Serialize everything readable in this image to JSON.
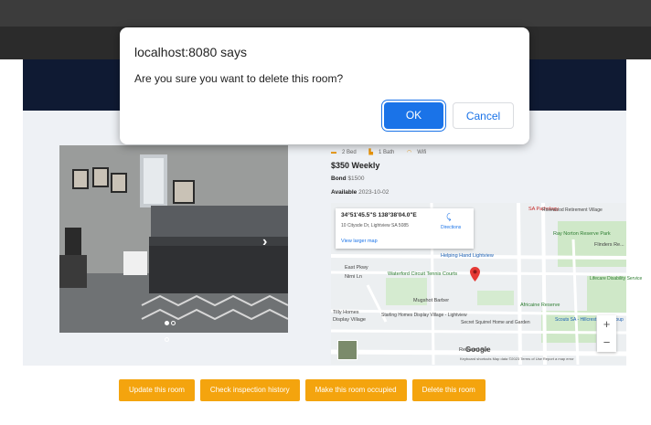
{
  "dialog": {
    "title": "localhost:8080 says",
    "message": "Are you sure you want to delete this room?",
    "ok_label": "OK",
    "cancel_label": "Cancel"
  },
  "room": {
    "features": {
      "beds": "2 Bed",
      "baths": "1 Bath",
      "wifi": "Wifi"
    },
    "price": "$350 Weekly",
    "bond_label": "Bond",
    "bond_value": "$1500",
    "available_label": "Available",
    "available_value": "2023-10-02",
    "carousel": {
      "total": 3,
      "active": 1
    }
  },
  "map": {
    "coords": "34°51'45.5\"S 138°38'04.0\"E",
    "address": "10 Citysde Dr, Lightview SA 5085",
    "directions": "Directions",
    "view_larger": "View larger map",
    "google": "Google",
    "attribution": "Keyboard shortcuts   Map data ©2023   Terms of Use   Report a map error",
    "zoom_in": "+",
    "zoom_out": "−",
    "labels": {
      "pathology": "SA Pathology",
      "ray_norton": "Ray Norton Reserve Park",
      "helping_hand": "Helping Hand Lightview",
      "waterford": "Waterford Circuit Tennis Courts",
      "mugshot": "Mugshot Barber",
      "africaine": "Africaine Reserve",
      "retirement": "Rosewood Retirement Village",
      "flinders": "Flinders Re...",
      "lifecare": "Lifecare Disability Service",
      "scouts": "Scouts SA - Hillcrest Scout Group",
      "starling": "Starling Homes Display Village - Lightview",
      "secret": "Secret Squirrel Home and Garden",
      "redward": "Redward Ave",
      "east_pkwy": "East Pkwy",
      "nirni": "Nirni Ln",
      "tilly": "Tilly Homes",
      "display": "Display Village"
    }
  },
  "actions": {
    "update": "Update this room",
    "inspection": "Check inspection history",
    "occupied": "Make this room occupied",
    "delete": "Delete this room"
  },
  "colors": {
    "accent_button": "#f4a40e",
    "dialog_ok": "#1a73e8",
    "nav_band": "#0f1a33"
  }
}
